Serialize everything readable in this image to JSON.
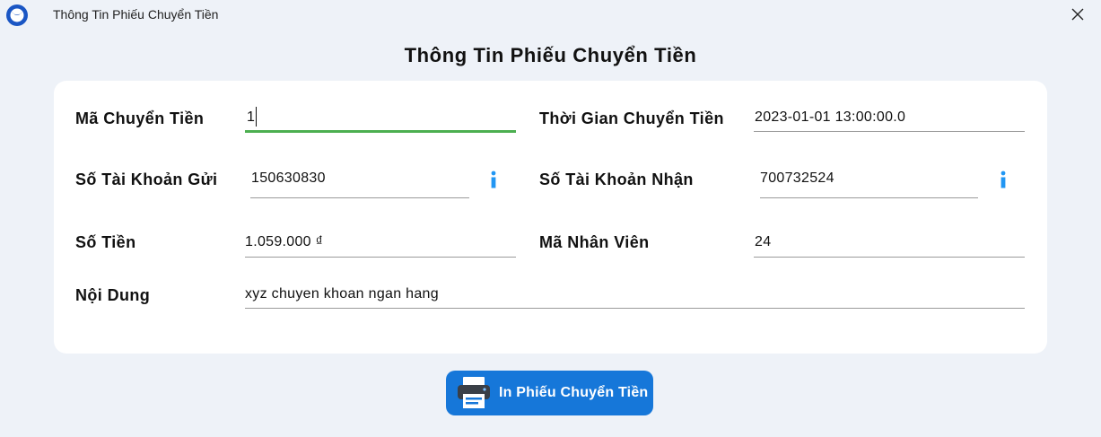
{
  "window": {
    "title": "Thông Tin Phiếu Chuyển Tiền",
    "icons": {
      "app": "app-logo-icon",
      "close": "close-icon"
    }
  },
  "page": {
    "title": "Thông Tin Phiếu Chuyển Tiền"
  },
  "form": {
    "ma_chuyen_tien": {
      "label": "Mã Chuyển Tiền",
      "value": "1"
    },
    "thoi_gian": {
      "label": "Thời Gian Chuyển Tiền",
      "value": "2023-01-01 13:00:00.0"
    },
    "tk_gui": {
      "label": "Số Tài Khoản Gửi",
      "value": "150630830",
      "icon": "info-icon"
    },
    "tk_nhan": {
      "label": "Số Tài Khoản Nhận",
      "value": "700732524",
      "icon": "info-icon"
    },
    "so_tien": {
      "label": "Số Tiền",
      "value": "1.059.000 ₫"
    },
    "ma_nhan_vien": {
      "label": "Mã Nhân Viên",
      "value": "24"
    },
    "noi_dung": {
      "label": "Nội Dung",
      "value": "xyz chuyen khoan ngan hang"
    }
  },
  "actions": {
    "print_label": "In Phiếu Chuyển Tiền",
    "print_icon": "printer-icon"
  },
  "colors": {
    "background": "#eef2f8",
    "card": "#ffffff",
    "accent_blue": "#1677d9",
    "focus_green": "#4caf50",
    "info_blue": "#2196f3"
  }
}
